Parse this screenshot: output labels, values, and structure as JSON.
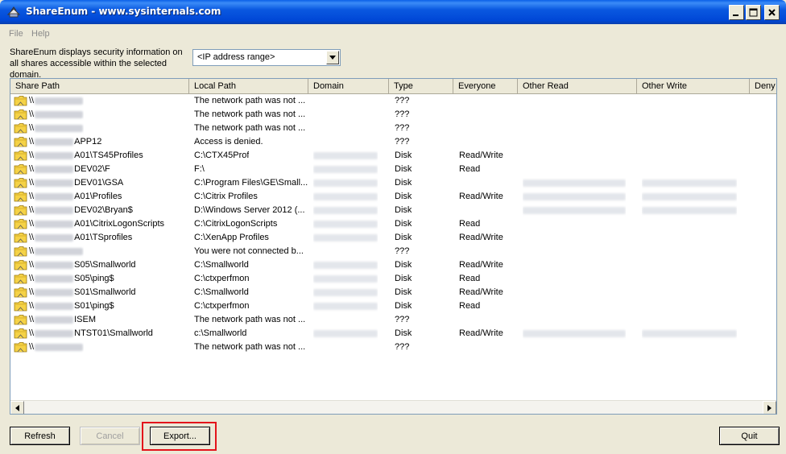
{
  "window": {
    "title": "ShareEnum - www.sysinternals.com",
    "minimize_icon": "minimize-icon",
    "maximize_icon": "maximize-icon",
    "close_icon": "close-icon"
  },
  "menu": {
    "items": [
      "File",
      "Help"
    ]
  },
  "description": "ShareEnum displays security information on all shares accessible within the selected domain.",
  "range_select": {
    "value": "<IP address range>"
  },
  "table": {
    "columns": [
      "Share Path",
      "Local Path",
      "Domain",
      "Type",
      "Everyone",
      "Other Read",
      "Other Write",
      "Deny"
    ],
    "rows": [
      {
        "share_prefix": "\\\\",
        "share_suffix": "",
        "local": "The network path was not ...",
        "type": "???",
        "everyone": "",
        "domain_hidden": false,
        "or_hidden": false,
        "ow_hidden": false
      },
      {
        "share_prefix": "\\\\",
        "share_suffix": "",
        "local": "The network path was not ...",
        "type": "???",
        "everyone": "",
        "domain_hidden": false,
        "or_hidden": false,
        "ow_hidden": false
      },
      {
        "share_prefix": "\\\\",
        "share_suffix": "",
        "local": "The network path was not ...",
        "type": "???",
        "everyone": "",
        "domain_hidden": false,
        "or_hidden": false,
        "ow_hidden": false
      },
      {
        "share_prefix": "\\\\",
        "share_suffix": "APP12",
        "local": "Access is denied.",
        "type": "???",
        "everyone": "",
        "domain_hidden": false,
        "or_hidden": false,
        "ow_hidden": false
      },
      {
        "share_prefix": "\\\\",
        "share_suffix": "A01\\TS45Profiles",
        "local": "C:\\CTX45Prof",
        "type": "Disk",
        "everyone": "Read/Write",
        "domain_hidden": true,
        "or_hidden": false,
        "ow_hidden": false
      },
      {
        "share_prefix": "\\\\",
        "share_suffix": "DEV02\\F",
        "local": "F:\\",
        "type": "Disk",
        "everyone": "Read",
        "domain_hidden": true,
        "or_hidden": false,
        "ow_hidden": false
      },
      {
        "share_prefix": "\\\\",
        "share_suffix": "DEV01\\GSA",
        "local": "C:\\Program Files\\GE\\Small...",
        "type": "Disk",
        "everyone": "",
        "domain_hidden": true,
        "or_hidden": true,
        "ow_hidden": true
      },
      {
        "share_prefix": "\\\\",
        "share_suffix": "A01\\Profiles",
        "local": "C:\\Citrix Profiles",
        "type": "Disk",
        "everyone": "Read/Write",
        "domain_hidden": true,
        "or_hidden": true,
        "ow_hidden": true
      },
      {
        "share_prefix": "\\\\",
        "share_suffix": "DEV02\\Bryan$",
        "local": "D:\\Windows Server 2012 (...",
        "type": "Disk",
        "everyone": "",
        "domain_hidden": true,
        "or_hidden": true,
        "ow_hidden": true
      },
      {
        "share_prefix": "\\\\",
        "share_suffix": "A01\\CitrixLogonScripts",
        "local": "C:\\CitrixLogonScripts",
        "type": "Disk",
        "everyone": "Read",
        "domain_hidden": true,
        "or_hidden": false,
        "ow_hidden": false
      },
      {
        "share_prefix": "\\\\",
        "share_suffix": "A01\\TSprofiles",
        "local": "C:\\XenApp Profiles",
        "type": "Disk",
        "everyone": "Read/Write",
        "domain_hidden": true,
        "or_hidden": false,
        "ow_hidden": false
      },
      {
        "share_prefix": "\\\\",
        "share_suffix": "",
        "local": "You were not connected b...",
        "type": "???",
        "everyone": "",
        "domain_hidden": false,
        "or_hidden": false,
        "ow_hidden": false
      },
      {
        "share_prefix": "\\\\",
        "share_suffix": "S05\\Smallworld",
        "local": "C:\\Smallworld",
        "type": "Disk",
        "everyone": "Read/Write",
        "domain_hidden": true,
        "or_hidden": false,
        "ow_hidden": false
      },
      {
        "share_prefix": "\\\\",
        "share_suffix": "S05\\ping$",
        "local": "C:\\ctxperfmon",
        "type": "Disk",
        "everyone": "Read",
        "domain_hidden": true,
        "or_hidden": false,
        "ow_hidden": false
      },
      {
        "share_prefix": "\\\\",
        "share_suffix": "S01\\Smallworld",
        "local": "C:\\Smallworld",
        "type": "Disk",
        "everyone": "Read/Write",
        "domain_hidden": true,
        "or_hidden": false,
        "ow_hidden": false
      },
      {
        "share_prefix": "\\\\",
        "share_suffix": "S01\\ping$",
        "local": "C:\\ctxperfmon",
        "type": "Disk",
        "everyone": "Read",
        "domain_hidden": true,
        "or_hidden": false,
        "ow_hidden": false
      },
      {
        "share_prefix": "\\\\",
        "share_suffix": "ISEM",
        "local": "The network path was not ...",
        "type": "???",
        "everyone": "",
        "domain_hidden": false,
        "or_hidden": false,
        "ow_hidden": false
      },
      {
        "share_prefix": "\\\\",
        "share_suffix": "NTST01\\Smallworld",
        "local": "c:\\Smallworld",
        "type": "Disk",
        "everyone": "Read/Write",
        "domain_hidden": true,
        "or_hidden": true,
        "ow_hidden": true
      },
      {
        "share_prefix": "\\\\",
        "share_suffix": "",
        "local": "The network path was not ...",
        "type": "???",
        "everyone": "",
        "domain_hidden": false,
        "or_hidden": false,
        "ow_hidden": false
      }
    ]
  },
  "buttons": {
    "refresh": "Refresh",
    "cancel": "Cancel",
    "export": "Export...",
    "quit": "Quit"
  },
  "colors": {
    "title_bar": "#0054e3",
    "highlight": "#e3141b",
    "window_face": "#ece9d8"
  }
}
